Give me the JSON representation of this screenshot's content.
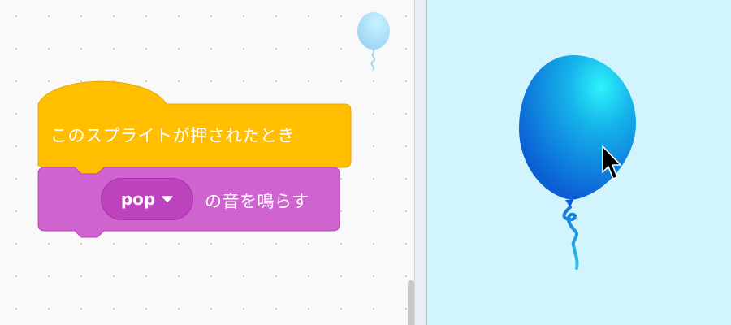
{
  "workspace": {
    "blocks": {
      "hat_block": {
        "label": "このスプライトが押されたとき",
        "color": "#ffbf00"
      },
      "play_sound_block": {
        "sound_menu_value": "pop",
        "label": "の音を鳴らす",
        "color": "#cf63cf"
      }
    },
    "sprite_thumbnail_icon": "balloon-icon"
  },
  "stage": {
    "background_color": "#d2f5fd",
    "sprite_icon": "balloon-icon",
    "cursor_icon": "mouse-pointer-icon"
  }
}
